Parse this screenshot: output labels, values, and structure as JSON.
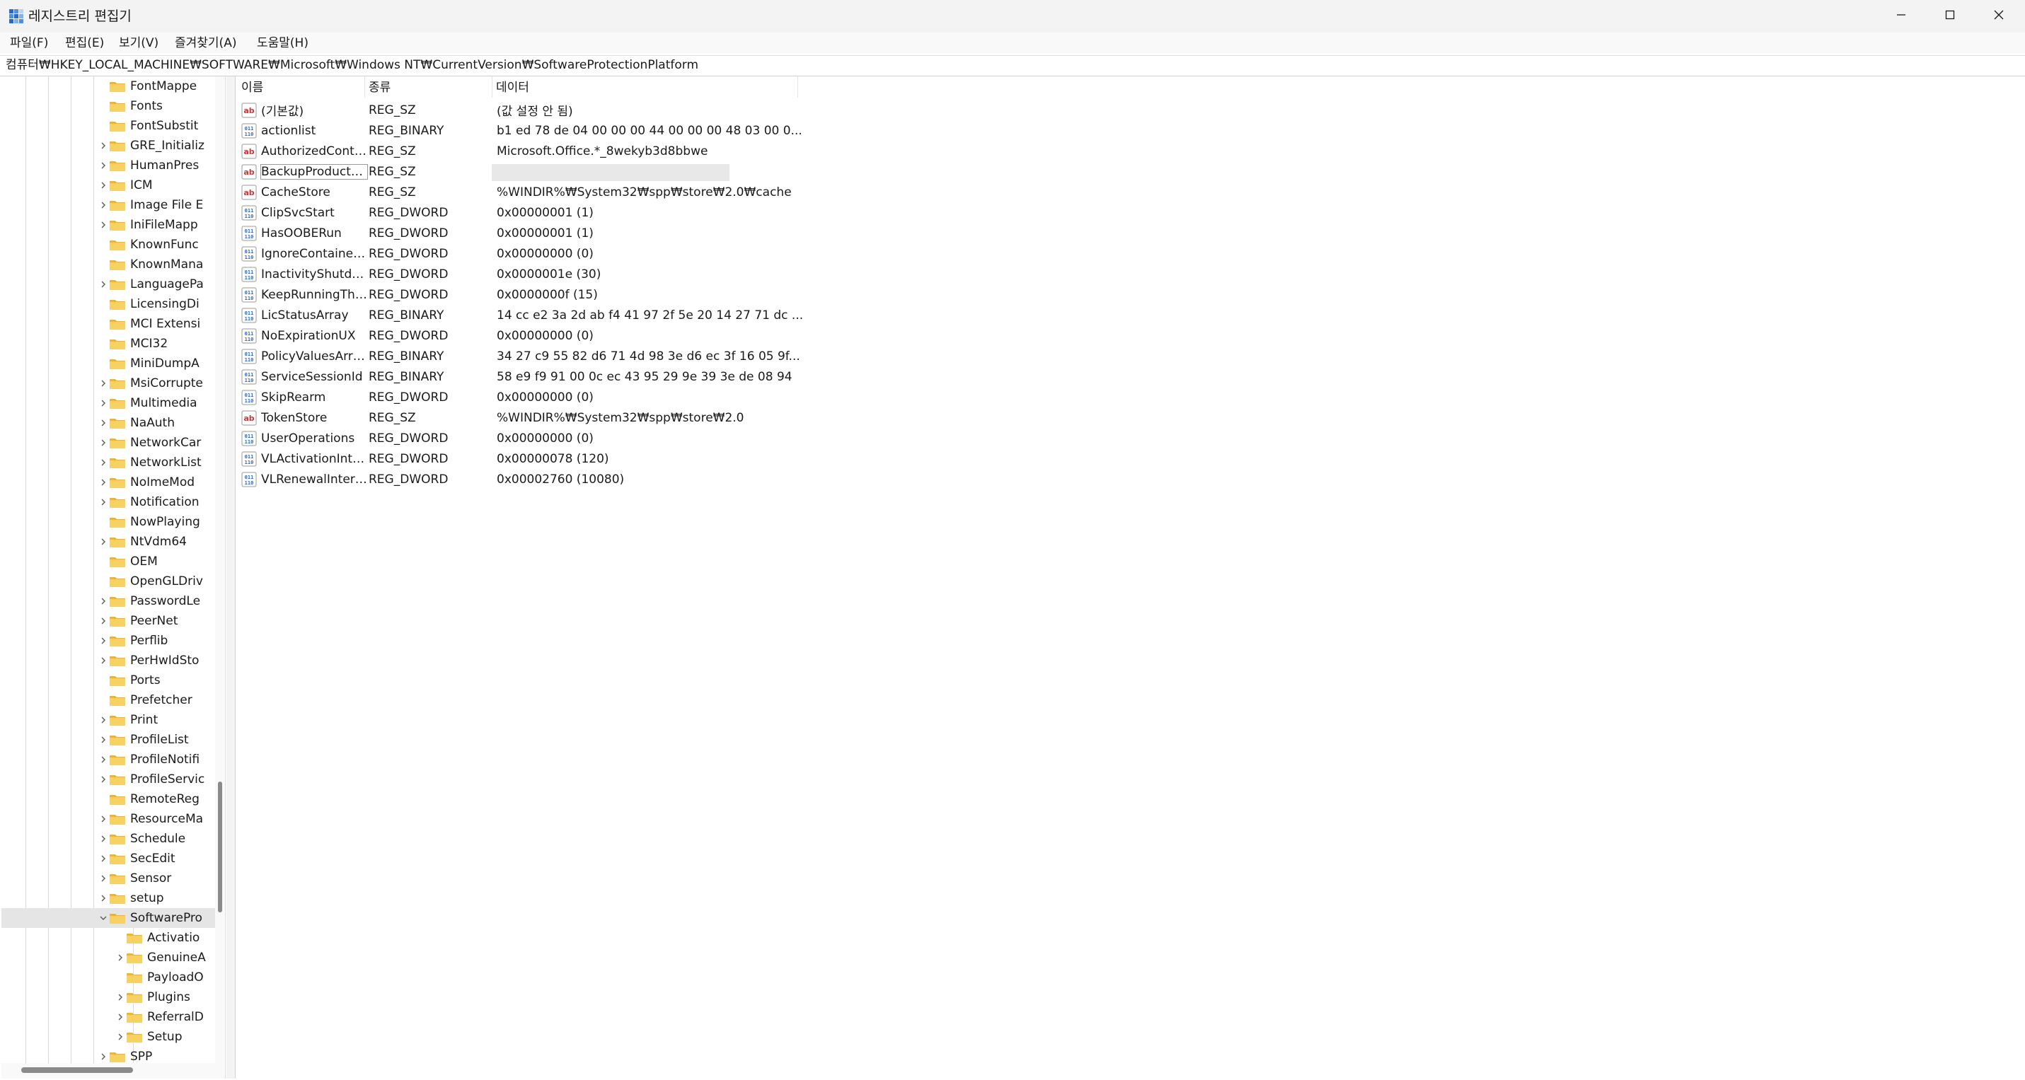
{
  "window": {
    "title": "레지스트리 편집기",
    "app_icon": "registry-icon",
    "controls": [
      "minimize-icon",
      "maximize-icon",
      "close-icon"
    ]
  },
  "menu": {
    "items": [
      {
        "label": "파일(F)"
      },
      {
        "label": "편집(E)"
      },
      {
        "label": "보기(V)"
      },
      {
        "label": "즐겨찾기(A)"
      },
      {
        "label": "도움말(H)"
      }
    ]
  },
  "address": {
    "path": "컴퓨터₩HKEY_LOCAL_MACHINE₩SOFTWARE₩Microsoft₩Windows NT₩CurrentVersion₩SoftwareProtectionPlatform"
  },
  "tree": {
    "items": [
      {
        "label": "FontMappe",
        "level": 0,
        "expander": "none"
      },
      {
        "label": "Fonts",
        "level": 0,
        "expander": "none"
      },
      {
        "label": "FontSubstit",
        "level": 0,
        "expander": "none"
      },
      {
        "label": "GRE_Initializ",
        "level": 0,
        "expander": "collapsed"
      },
      {
        "label": "HumanPres",
        "level": 0,
        "expander": "collapsed"
      },
      {
        "label": "ICM",
        "level": 0,
        "expander": "collapsed"
      },
      {
        "label": "Image File E",
        "level": 0,
        "expander": "collapsed"
      },
      {
        "label": "IniFileMapp",
        "level": 0,
        "expander": "collapsed"
      },
      {
        "label": "KnownFunc",
        "level": 0,
        "expander": "none"
      },
      {
        "label": "KnownMana",
        "level": 0,
        "expander": "none"
      },
      {
        "label": "LanguagePa",
        "level": 0,
        "expander": "collapsed"
      },
      {
        "label": "LicensingDi",
        "level": 0,
        "expander": "none"
      },
      {
        "label": "MCI Extensi",
        "level": 0,
        "expander": "none"
      },
      {
        "label": "MCI32",
        "level": 0,
        "expander": "none"
      },
      {
        "label": "MiniDumpA",
        "level": 0,
        "expander": "none"
      },
      {
        "label": "MsiCorrupte",
        "level": 0,
        "expander": "collapsed"
      },
      {
        "label": "Multimedia",
        "level": 0,
        "expander": "collapsed"
      },
      {
        "label": "NaAuth",
        "level": 0,
        "expander": "collapsed"
      },
      {
        "label": "NetworkCar",
        "level": 0,
        "expander": "collapsed"
      },
      {
        "label": "NetworkList",
        "level": 0,
        "expander": "collapsed"
      },
      {
        "label": "NoImeMod",
        "level": 0,
        "expander": "collapsed"
      },
      {
        "label": "Notification",
        "level": 0,
        "expander": "collapsed"
      },
      {
        "label": "NowPlaying",
        "level": 0,
        "expander": "none"
      },
      {
        "label": "NtVdm64",
        "level": 0,
        "expander": "collapsed"
      },
      {
        "label": "OEM",
        "level": 0,
        "expander": "none"
      },
      {
        "label": "OpenGLDriv",
        "level": 0,
        "expander": "none"
      },
      {
        "label": "PasswordLe",
        "level": 0,
        "expander": "collapsed"
      },
      {
        "label": "PeerNet",
        "level": 0,
        "expander": "collapsed"
      },
      {
        "label": "Perflib",
        "level": 0,
        "expander": "collapsed"
      },
      {
        "label": "PerHwIdSto",
        "level": 0,
        "expander": "collapsed"
      },
      {
        "label": "Ports",
        "level": 0,
        "expander": "none"
      },
      {
        "label": "Prefetcher",
        "level": 0,
        "expander": "none"
      },
      {
        "label": "Print",
        "level": 0,
        "expander": "collapsed"
      },
      {
        "label": "ProfileList",
        "level": 0,
        "expander": "collapsed"
      },
      {
        "label": "ProfileNotifi",
        "level": 0,
        "expander": "collapsed"
      },
      {
        "label": "ProfileServic",
        "level": 0,
        "expander": "collapsed"
      },
      {
        "label": "RemoteReg",
        "level": 0,
        "expander": "none"
      },
      {
        "label": "ResourceMa",
        "level": 0,
        "expander": "collapsed"
      },
      {
        "label": "Schedule",
        "level": 0,
        "expander": "collapsed"
      },
      {
        "label": "SecEdit",
        "level": 0,
        "expander": "collapsed"
      },
      {
        "label": "Sensor",
        "level": 0,
        "expander": "collapsed"
      },
      {
        "label": "setup",
        "level": 0,
        "expander": "collapsed"
      },
      {
        "label": "SoftwarePro",
        "level": 0,
        "expander": "expanded",
        "selected": true
      },
      {
        "label": "Activatio",
        "level": 1,
        "expander": "none"
      },
      {
        "label": "GenuineA",
        "level": 1,
        "expander": "collapsed"
      },
      {
        "label": "PayloadO",
        "level": 1,
        "expander": "none"
      },
      {
        "label": "Plugins",
        "level": 1,
        "expander": "collapsed"
      },
      {
        "label": "ReferralD",
        "level": 1,
        "expander": "collapsed"
      },
      {
        "label": "Setup",
        "level": 1,
        "expander": "collapsed"
      },
      {
        "label": "SPP",
        "level": 0,
        "expander": "collapsed"
      }
    ]
  },
  "values": {
    "headers": {
      "name": "이름",
      "type": "종류",
      "data": "데이터"
    },
    "rows": [
      {
        "icon": "string-value-icon",
        "name": "(기본값)",
        "type": "REG_SZ",
        "data": "(값 설정 안 됨)"
      },
      {
        "icon": "binary-value-icon",
        "name": "actionlist",
        "type": "REG_BINARY",
        "data": "b1 ed 78 de 04 00 00 00 44 00 00 00 48 03 00 0..."
      },
      {
        "icon": "string-value-icon",
        "name": "AuthorizedConta...",
        "type": "REG_SZ",
        "data": "Microsoft.Office.*_8wekyb3d8bbwe"
      },
      {
        "icon": "string-value-icon",
        "name": "BackupProductK...",
        "type": "REG_SZ",
        "data": "",
        "focused": true,
        "blurred": true
      },
      {
        "icon": "string-value-icon",
        "name": "CacheStore",
        "type": "REG_SZ",
        "data": "%WINDIR%₩System32₩spp₩store₩2.0₩cache"
      },
      {
        "icon": "binary-value-icon",
        "name": "ClipSvcStart",
        "type": "REG_DWORD",
        "data": "0x00000001 (1)"
      },
      {
        "icon": "binary-value-icon",
        "name": "HasOOBERun",
        "type": "REG_DWORD",
        "data": "0x00000001 (1)"
      },
      {
        "icon": "binary-value-icon",
        "name": "IgnoreContainer...",
        "type": "REG_DWORD",
        "data": "0x00000000 (0)"
      },
      {
        "icon": "binary-value-icon",
        "name": "InactivityShutdo...",
        "type": "REG_DWORD",
        "data": "0x0000001e (30)"
      },
      {
        "icon": "binary-value-icon",
        "name": "KeepRunningThr...",
        "type": "REG_DWORD",
        "data": "0x0000000f (15)"
      },
      {
        "icon": "binary-value-icon",
        "name": "LicStatusArray",
        "type": "REG_BINARY",
        "data": "14 cc e2 3a 2d ab f4 41 97 2f 5e 20 14 27 71 dc ..."
      },
      {
        "icon": "binary-value-icon",
        "name": "NoExpirationUX",
        "type": "REG_DWORD",
        "data": "0x00000000 (0)"
      },
      {
        "icon": "binary-value-icon",
        "name": "PolicyValuesArray",
        "type": "REG_BINARY",
        "data": "34 27 c9 55 82 d6 71 4d 98 3e d6 ec 3f 16 05 9f..."
      },
      {
        "icon": "binary-value-icon",
        "name": "ServiceSessionId",
        "type": "REG_BINARY",
        "data": "58 e9 f9 91 00 0c ec 43 95 29 9e 39 3e de 08 94"
      },
      {
        "icon": "binary-value-icon",
        "name": "SkipRearm",
        "type": "REG_DWORD",
        "data": "0x00000000 (0)"
      },
      {
        "icon": "string-value-icon",
        "name": "TokenStore",
        "type": "REG_SZ",
        "data": "%WINDIR%₩System32₩spp₩store₩2.0"
      },
      {
        "icon": "binary-value-icon",
        "name": "UserOperations",
        "type": "REG_DWORD",
        "data": "0x00000000 (0)"
      },
      {
        "icon": "binary-value-icon",
        "name": "VLActivationInte...",
        "type": "REG_DWORD",
        "data": "0x00000078 (120)"
      },
      {
        "icon": "binary-value-icon",
        "name": "VLRenewalInterval",
        "type": "REG_DWORD",
        "data": "0x00002760 (10080)"
      }
    ]
  },
  "colors": {
    "titlebar_bg": "#f3f3f3",
    "folder_yellow": "#f2c94c",
    "string_icon_red": "#d13438",
    "binary_icon_blue": "#2b67c6",
    "selection_gray": "#e5e5e5"
  }
}
